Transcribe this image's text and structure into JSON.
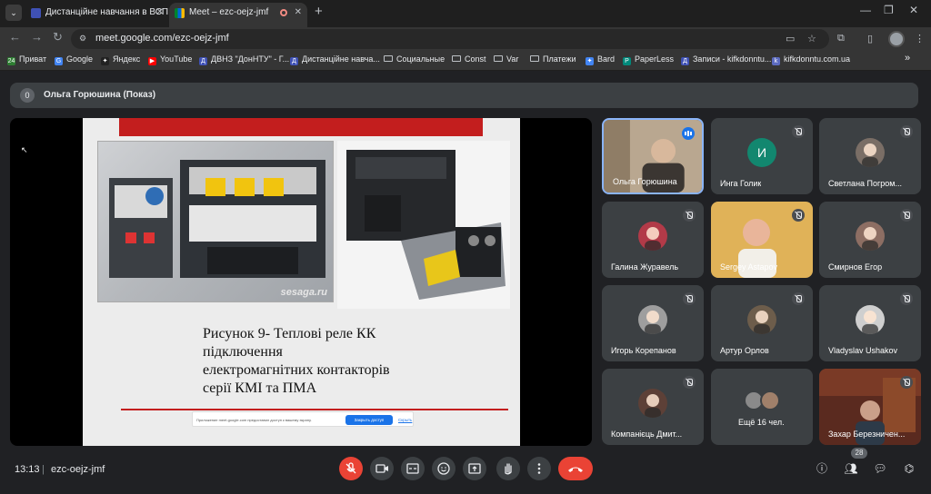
{
  "tabs": [
    {
      "title": "Дистанційне навчання в ВСП",
      "close": "✕"
    },
    {
      "title": "Meet – ezc-oejz-jmf",
      "close": "✕"
    }
  ],
  "toolbar": {
    "url": "meet.google.com/ezc-oejz-jmf"
  },
  "bookmarks": [
    {
      "label": "Приват",
      "color": "#2e7d32",
      "glyph": "24"
    },
    {
      "label": "Google",
      "color": "#4285f4",
      "glyph": "G"
    },
    {
      "label": "Яндекс",
      "color": "#222222",
      "glyph": "✦"
    },
    {
      "label": "YouTube",
      "color": "#ff0000",
      "glyph": "▶"
    },
    {
      "label": "ДВНЗ \"ДонНТУ\" - Г...",
      "color": "#3f51b5",
      "glyph": "Д"
    },
    {
      "label": "Дистанційне навча...",
      "color": "#3f51b5",
      "glyph": "Д"
    },
    {
      "label": "Социальные",
      "folder": true
    },
    {
      "label": "Const",
      "folder": true
    },
    {
      "label": "Var",
      "folder": true
    },
    {
      "label": "Платежи",
      "folder": true
    },
    {
      "label": "Bard",
      "color": "#4285f4",
      "glyph": "✦"
    },
    {
      "label": "PaperLess",
      "color": "#00897b",
      "glyph": "P"
    },
    {
      "label": "Записи - kifkdonntu...",
      "color": "#3f51b5",
      "glyph": "Д"
    },
    {
      "label": "kifkdonntu.com.ua",
      "color": "#5c6bc0",
      "glyph": "k"
    }
  ],
  "presenter": {
    "badge": "0",
    "name": "Ольга Горюшина (Показ)"
  },
  "slide": {
    "watermark": "sesaga.ru",
    "caption": [
      "Рисунок 9- Теплові реле КК",
      "підключення",
      "електромагнітних  контакторів",
      "серії КМІ та  ПМА"
    ],
    "share_text": "Приложение meet.google.com предоставил доступ к вашему экрану.",
    "share_stop": "Закрыть доступ",
    "share_hide": "Скрыть"
  },
  "participants": [
    {
      "name": "Ольга Горюшина",
      "kind": "video",
      "speaking": true
    },
    {
      "name": "Инга Голик",
      "kind": "initial",
      "initial": "И"
    },
    {
      "name": "Светлана Погром...",
      "kind": "avatar",
      "color": "#7a6e66"
    },
    {
      "name": "Галина Журавель",
      "kind": "avatar",
      "color": "#b23a48"
    },
    {
      "name": "Sergey Astapov",
      "kind": "video"
    },
    {
      "name": "Смирнов Егор",
      "kind": "avatar",
      "color": "#8d6e63"
    },
    {
      "name": "Игорь Корепанов",
      "kind": "avatar",
      "color": "#9e9e9e"
    },
    {
      "name": "Артур Орлов",
      "kind": "avatar",
      "color": "#6d5d4b"
    },
    {
      "name": "Vladyslav Ushakov",
      "kind": "avatar",
      "color": "#cfcfcf"
    },
    {
      "name": "Компанієць Дмит...",
      "kind": "avatar",
      "color": "#5d4037"
    },
    {
      "name": "Ещё 16 чел.",
      "kind": "more"
    },
    {
      "name": "Захар Березничен...",
      "kind": "video"
    }
  ],
  "bottom": {
    "time": "13:13",
    "separator": "|",
    "meeting_code": "ezc-oejz-jmf",
    "people_count": "28"
  },
  "colors": {
    "accent": "#8ab4f8",
    "end_call": "#ea4335",
    "slide_red": "#c31e1e"
  }
}
